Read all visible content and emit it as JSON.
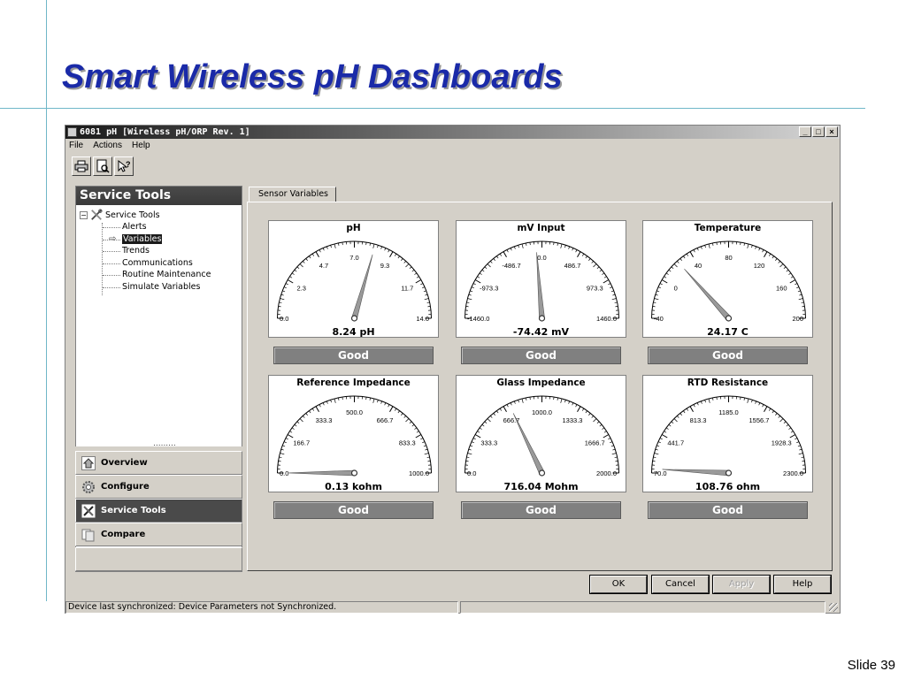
{
  "slide": {
    "title": "Smart Wireless pH Dashboards",
    "slide_number": "Slide 39"
  },
  "window": {
    "title": "6081 pH [Wireless pH/ORP Rev. 1]",
    "controls": [
      "_",
      "□",
      "×"
    ]
  },
  "menu": [
    "File",
    "Actions",
    "Help"
  ],
  "toolbar": {
    "icons": [
      "print-icon",
      "print-preview-icon",
      "whats-this-help-icon"
    ]
  },
  "left_panel": {
    "header": "Service Tools",
    "tree_root": "Service Tools",
    "tree_items": [
      "Alerts",
      "Variables",
      "Trends",
      "Communications",
      "Routine Maintenance",
      "Simulate Variables"
    ],
    "selected_item": "Variables"
  },
  "nav": [
    {
      "label": "Overview",
      "icon": "home-icon"
    },
    {
      "label": "Configure",
      "icon": "gear-icon"
    },
    {
      "label": "Service Tools",
      "icon": "tools-icon"
    },
    {
      "label": "Compare",
      "icon": "compare-icon"
    }
  ],
  "active_nav": "Service Tools",
  "tab": "Sensor Variables",
  "gauges": [
    {
      "title": "pH",
      "reading": "8.24 pH",
      "status": "Good",
      "labels": [
        "0.0",
        "2.3",
        "4.7",
        "7.0",
        "9.3",
        "11.7",
        "14.0"
      ],
      "min": 0,
      "max": 14,
      "value": 8.24
    },
    {
      "title": "mV Input",
      "reading": "-74.42 mV",
      "status": "Good",
      "labels": [
        "-1460.0",
        "-973.3",
        "-486.7",
        "0.0",
        "486.7",
        "973.3",
        "1460.0"
      ],
      "min": -1460,
      "max": 1460,
      "value": -74.42
    },
    {
      "title": "Temperature",
      "reading": "24.17 C",
      "status": "Good",
      "labels": [
        "-40",
        "0",
        "40",
        "80",
        "120",
        "160",
        "200"
      ],
      "min": -40,
      "max": 200,
      "value": 24.17
    },
    {
      "title": "Reference Impedance",
      "reading": "0.13 kohm",
      "status": "Good",
      "labels": [
        "0.0",
        "166.7",
        "333.3",
        "500.0",
        "666.7",
        "833.3",
        "1000.0"
      ],
      "min": 0,
      "max": 1000,
      "value": 0.13
    },
    {
      "title": "Glass Impedance",
      "reading": "716.04 Mohm",
      "status": "Good",
      "labels": [
        "0.0",
        "333.3",
        "666.7",
        "1000.0",
        "1333.3",
        "1666.7",
        "2000.0"
      ],
      "min": 0,
      "max": 2000,
      "value": 716.04
    },
    {
      "title": "RTD Resistance",
      "reading": "108.76 ohm",
      "status": "Good",
      "labels": [
        "70.0",
        "441.7",
        "813.3",
        "1185.0",
        "1556.7",
        "1928.3",
        "2300.0"
      ],
      "min": 70,
      "max": 2300,
      "value": 108.76
    }
  ],
  "buttons": {
    "ok": "OK",
    "cancel": "Cancel",
    "apply": "Apply",
    "help": "Help"
  },
  "status_text": "Device last synchronized: Device Parameters not Synchronized."
}
